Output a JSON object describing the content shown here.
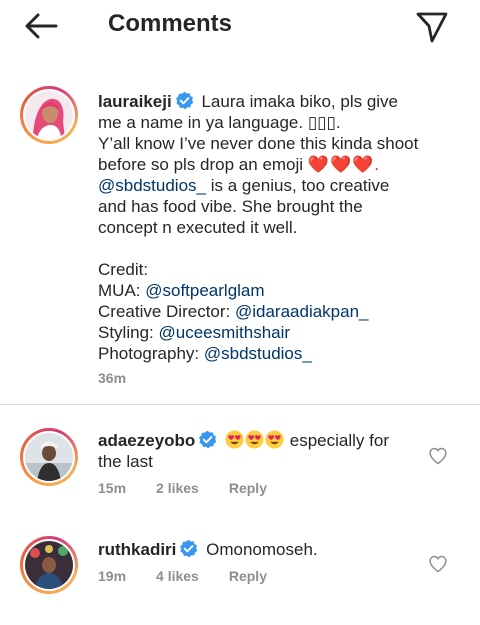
{
  "header": {
    "title": "Comments"
  },
  "caption": {
    "username": "lauraikeji",
    "line1": "Laura imaka biko, pls give",
    "line2": "me a name in ya language. ",
    "line2_symbols": "▯▯▯.",
    "line3": "Y’all know I’ve never done this kinda shoot",
    "line4": "before so pls drop an emoji ",
    "line4_emoji": "❤️❤️❤️.",
    "line5_mention": "@sbdstudios_",
    "line5_rest": " is a genius, too creative",
    "line6": "and has food vibe. She brought the",
    "line7": "concept n executed it well.",
    "credit_title": "Credit:",
    "mua_label": "MUA: ",
    "mua_handle": "@softpearlglam",
    "creative_label": "Creative Director: ",
    "creative_handle": "@idaraadiakpan_",
    "styling_label": "Styling: ",
    "styling_handle": "@uceesmithshair",
    "photo_label": "Photography: ",
    "photo_handle": "@sbdstudios_",
    "time": "36m"
  },
  "comments": [
    {
      "username": "adaezeyobo",
      "text_after_emoji": " especially for",
      "text_line2": "the last",
      "time": "15m",
      "likes": "2 likes",
      "reply": "Reply"
    },
    {
      "username": "ruthkadiri",
      "text": "Omonomoseh.",
      "time": "19m",
      "likes": "4 likes",
      "reply": "Reply"
    }
  ],
  "colors": {
    "verified_blue": "#3897f0",
    "mention": "#003569",
    "meta_gray": "#8e8e8e"
  }
}
